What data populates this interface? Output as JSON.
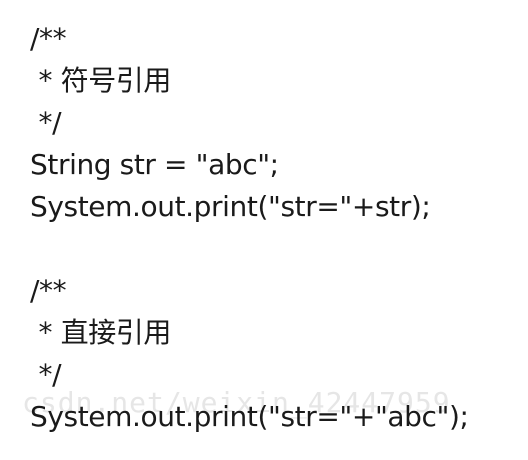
{
  "lines": [
    "/**",
    " * 符号引用",
    " */",
    "String str = \"abc\";",
    "System.out.print(\"str=\"+str);",
    "",
    "/**",
    " * 直接引用",
    " */",
    "System.out.print(\"str=\"+\"abc\");"
  ],
  "watermark": "csdn.net/weixin_42447959",
  "colors": {
    "text": "#1a1a1a",
    "watermark": "#e6e6e6",
    "background": "#ffffff"
  }
}
